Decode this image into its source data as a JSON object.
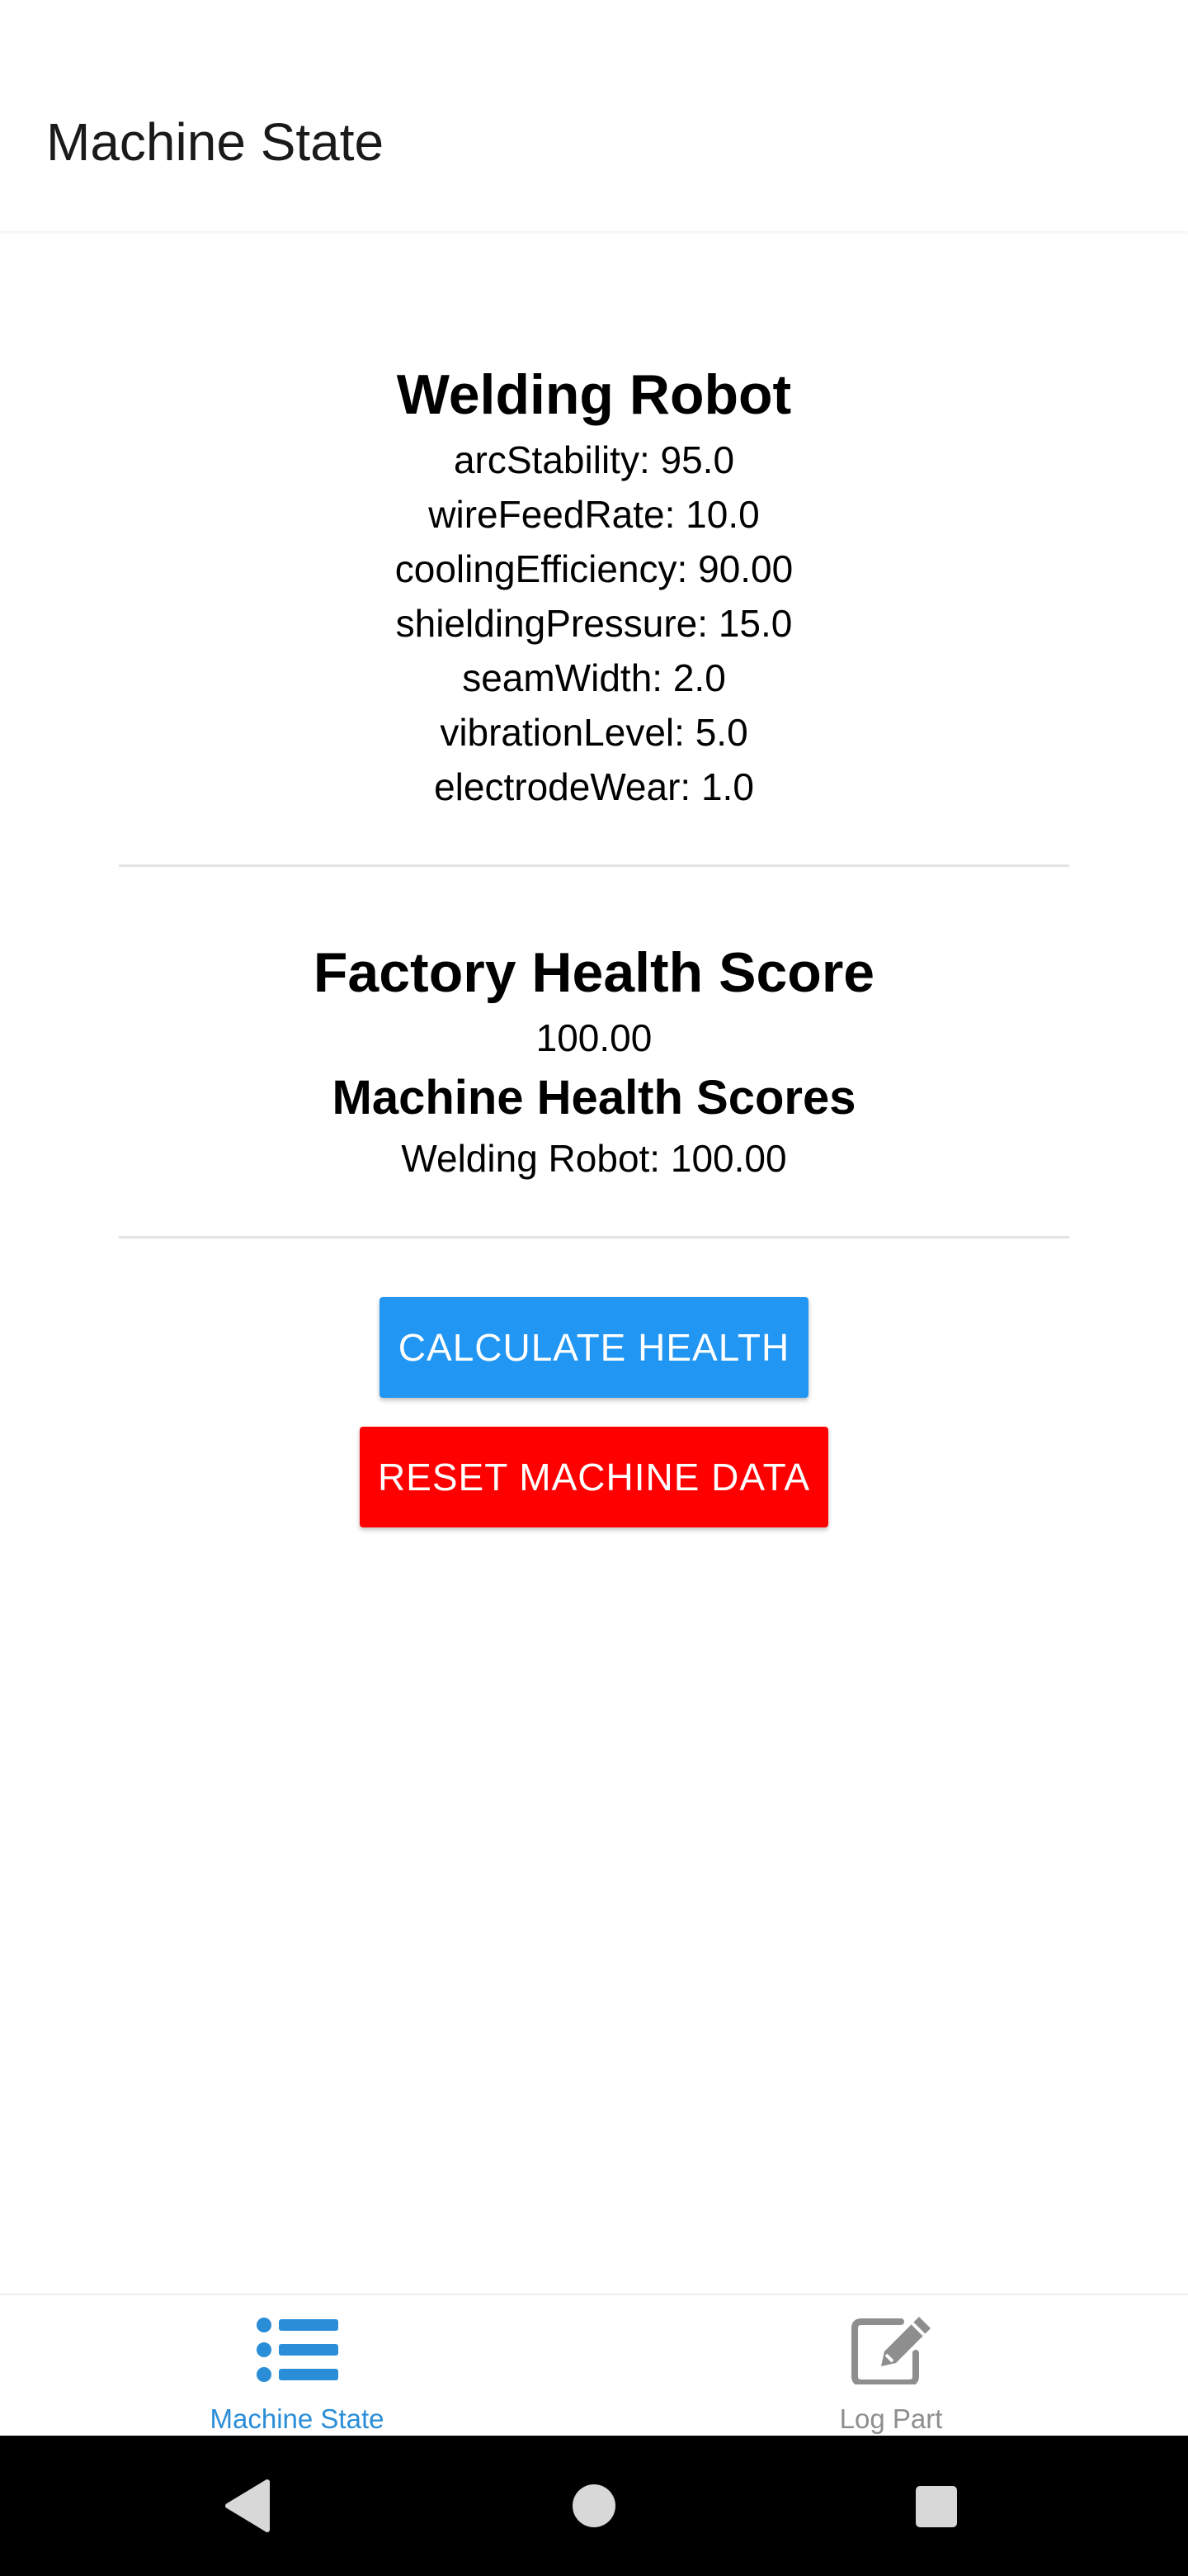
{
  "header": {
    "title": "Machine State"
  },
  "machine": {
    "name": "Welding Robot",
    "params": [
      "arcStability: 95.0",
      "wireFeedRate: 10.0",
      "coolingEfficiency: 90.00",
      "shieldingPressure: 15.0",
      "seamWidth: 2.0",
      "vibrationLevel: 5.0",
      "electrodeWear: 1.0"
    ]
  },
  "health": {
    "factory_title": "Factory Health Score",
    "factory_value": "100.00",
    "machine_scores_title": "Machine Health Scores",
    "machine_scores": [
      "Welding Robot: 100.00"
    ]
  },
  "buttons": {
    "calculate_label": "CALCULATE HEALTH",
    "reset_label": "RESET MACHINE DATA"
  },
  "tabs": [
    {
      "label": "Machine State",
      "icon": "list-icon",
      "active": true
    },
    {
      "label": "Log Part",
      "icon": "edit-icon",
      "active": false
    }
  ],
  "colors": {
    "primary_button": "#2196f3",
    "reset_button": "#ff0000",
    "active_tab": "#2a8dd8",
    "inactive_tab": "#8e8e8e"
  },
  "system_nav": {
    "back": "back-icon",
    "home": "home-icon",
    "recents": "recents-icon"
  }
}
